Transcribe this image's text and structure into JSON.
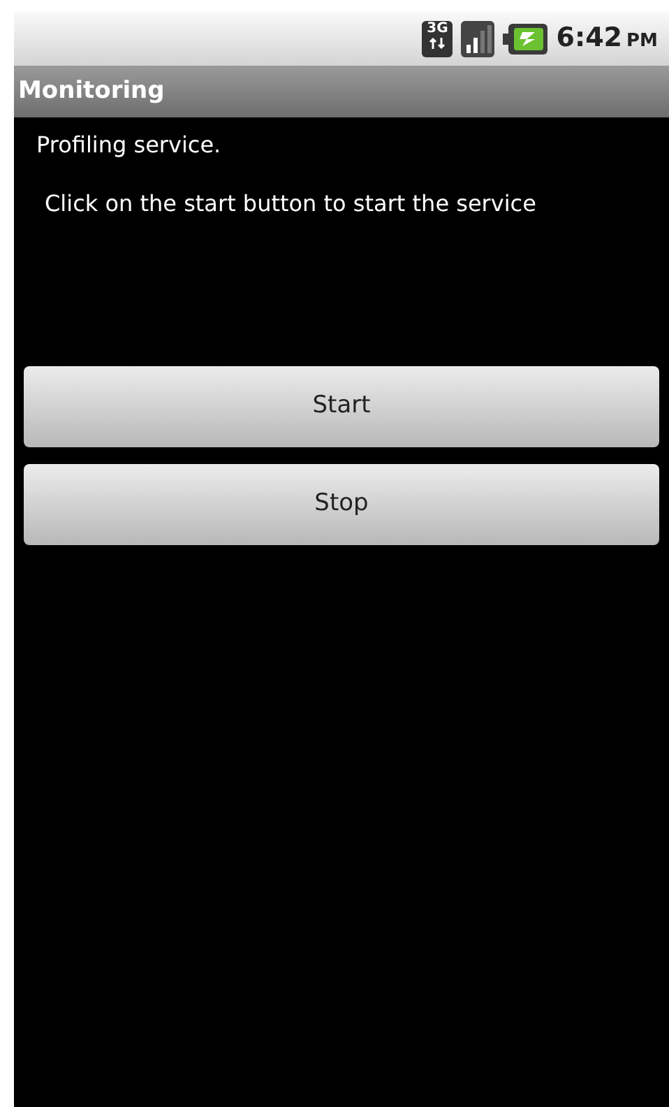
{
  "status_bar": {
    "network": "3G",
    "time": "6:42",
    "meridiem": "PM"
  },
  "title_bar": {
    "title": "Monitoring"
  },
  "content": {
    "heading": "Profiling service.",
    "instruction": "Click on the start button to start the service"
  },
  "buttons": [
    {
      "label": "Start"
    },
    {
      "label": "Stop"
    }
  ]
}
